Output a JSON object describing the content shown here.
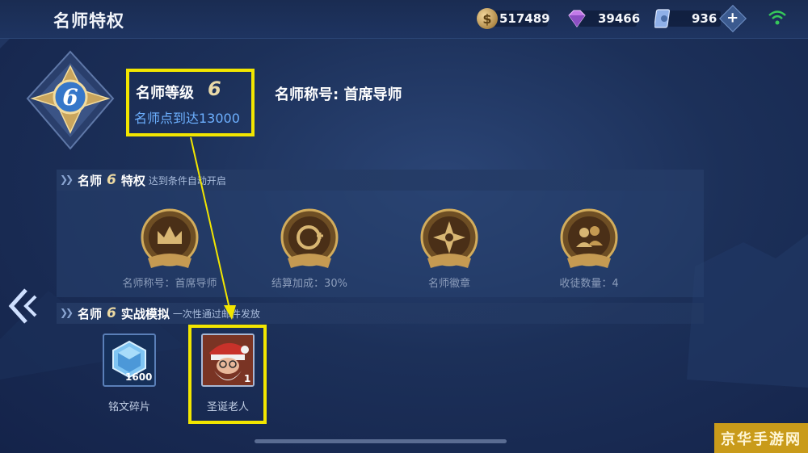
{
  "header": {
    "title": "名师特权",
    "coins": "517489",
    "gems": "39466",
    "tickets": "936"
  },
  "mentor": {
    "level_label": "名师等级",
    "level": "6",
    "requirement": "名师点到达13000",
    "title_label": "名师称号: 首席导师"
  },
  "privileges": {
    "head_prefix": "名师",
    "level": "6",
    "head_suffix": "特权",
    "note": "达到条件自动开启",
    "items": [
      {
        "label": "名师称号：首席导师",
        "icon": "crown-icon"
      },
      {
        "label": "结算加成：30%",
        "icon": "coin-bonus-icon"
      },
      {
        "label": "名师徽章",
        "icon": "badge-icon"
      },
      {
        "label": "收徒数量：4",
        "icon": "apprentice-icon"
      }
    ]
  },
  "simulation": {
    "head_prefix": "名师",
    "level": "6",
    "head_suffix": "实战模拟",
    "note": "一次性通过邮件发放",
    "items": [
      {
        "label": "铭文碎片",
        "count": "1600",
        "icon": "inscription-shard-icon"
      },
      {
        "label": "圣诞老人",
        "count": "1",
        "icon": "santa-avatar-icon"
      }
    ]
  },
  "watermark": "京华手游网",
  "colors": {
    "highlight": "#f2e600",
    "accent_blue": "#6db0ff",
    "gold": "#ecd9a2"
  }
}
